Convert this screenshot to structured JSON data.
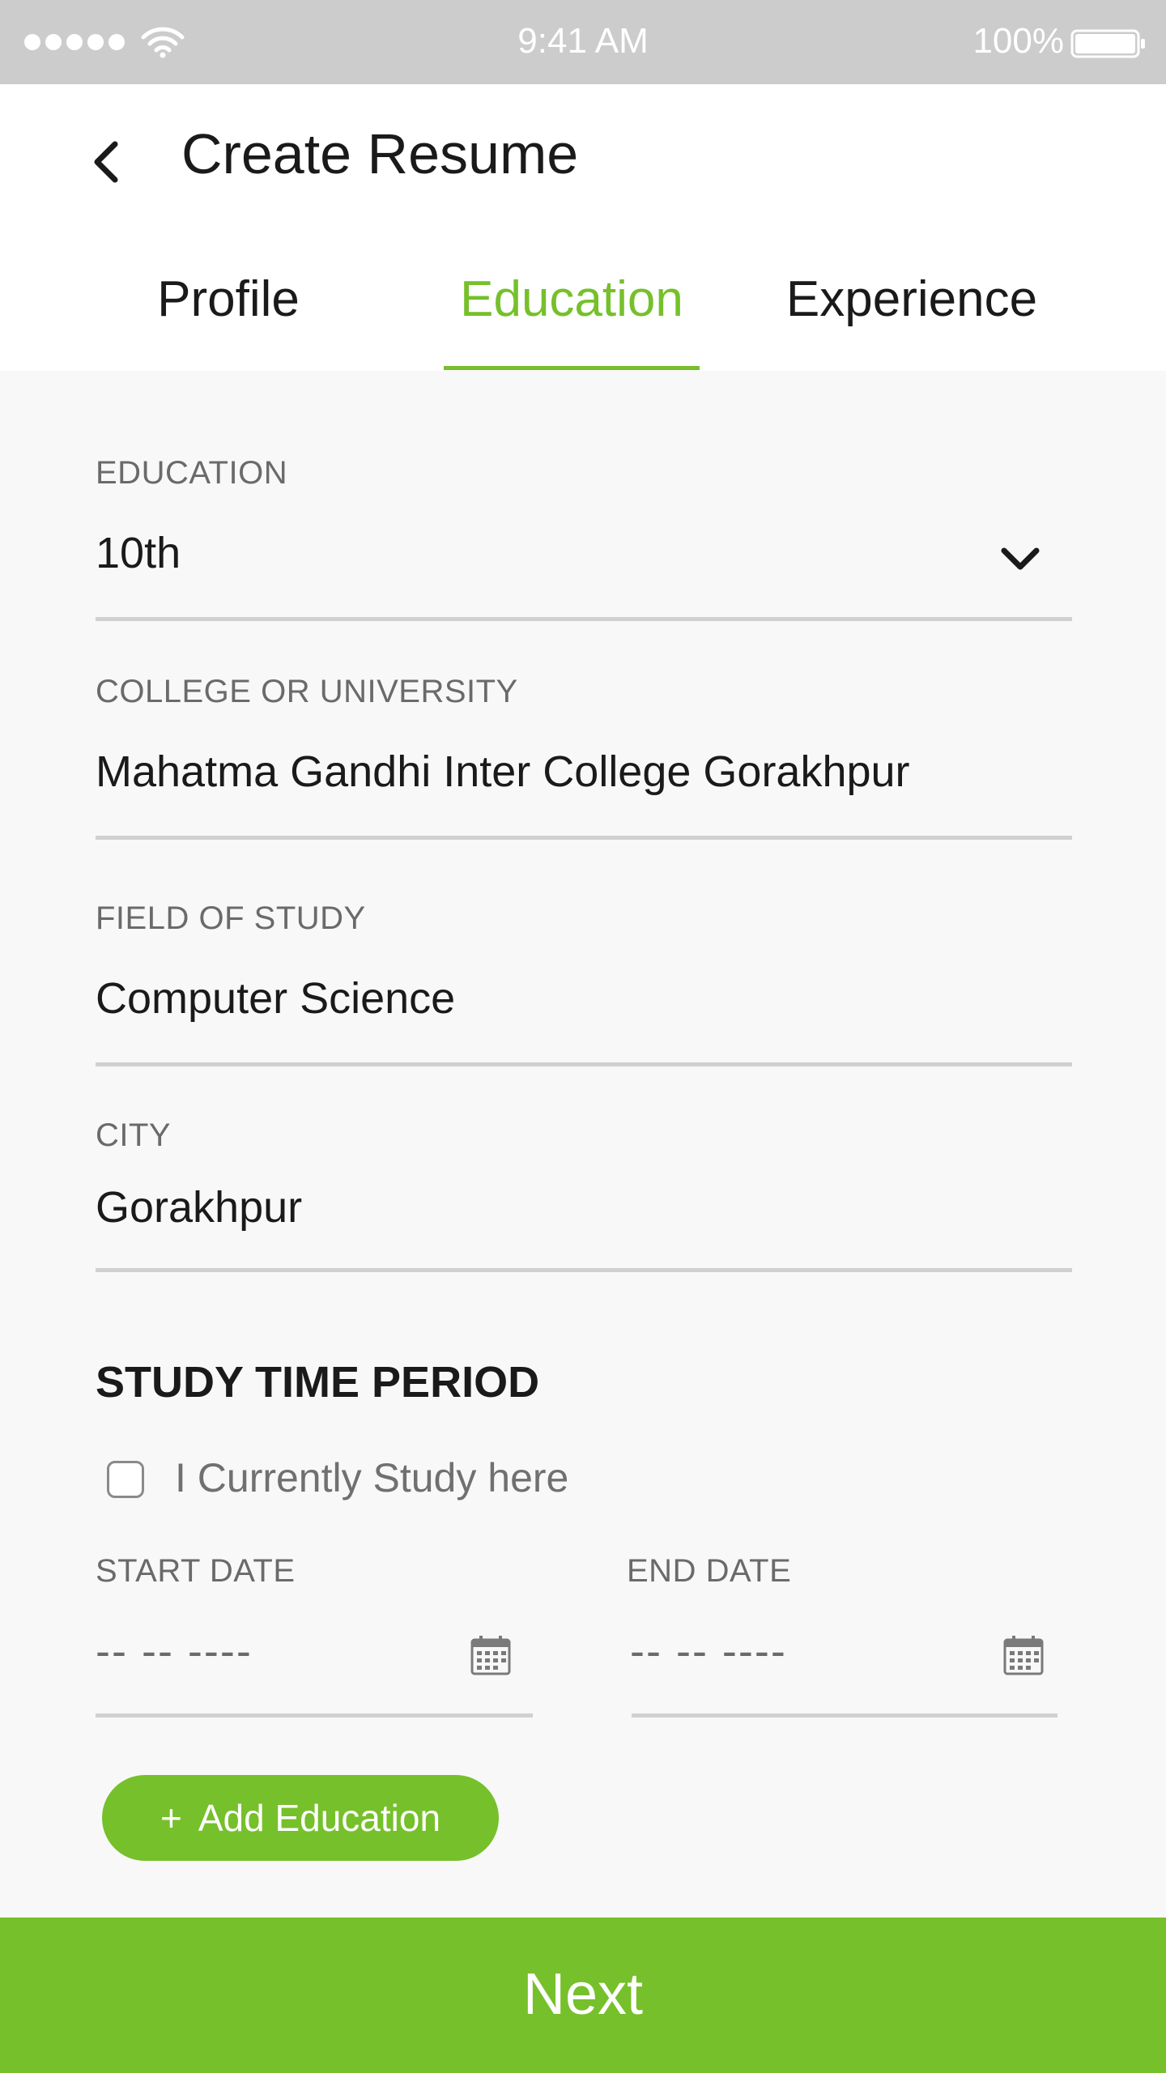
{
  "status_bar": {
    "time": "9:41 AM",
    "battery": "100%"
  },
  "header": {
    "title": "Create Resume"
  },
  "tabs": [
    {
      "label": "Profile",
      "active": false
    },
    {
      "label": "Education",
      "active": true
    },
    {
      "label": "Experience",
      "active": false
    }
  ],
  "form": {
    "education": {
      "label": "EDUCATION",
      "value": "10th"
    },
    "college": {
      "label": "COLLEGE OR UNIVERSITY",
      "value": "Mahatma Gandhi Inter College Gorakhpur"
    },
    "field_of_study": {
      "label": "FIELD OF STUDY",
      "value": "Computer Science"
    },
    "city": {
      "label": "CITY",
      "value": "Gorakhpur"
    }
  },
  "study_period": {
    "heading": "STUDY TIME PERIOD",
    "currently_study_label": "I Currently Study here",
    "currently_study_checked": false,
    "start_date": {
      "label": "START DATE",
      "placeholder": "-- -- ----"
    },
    "end_date": {
      "label": "END DATE",
      "placeholder": "-- -- ----"
    }
  },
  "add_button": {
    "icon": "+",
    "label": "Add Education"
  },
  "next_button": {
    "label": "Next"
  },
  "colors": {
    "accent": "#76c02b",
    "status_bar": "#cccccc",
    "background": "#f8f8f8"
  }
}
